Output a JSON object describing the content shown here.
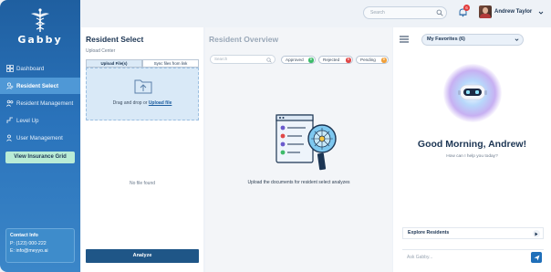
{
  "brand": {
    "name": "Gabby"
  },
  "sidebar": {
    "items": [
      {
        "label": "Dashboard",
        "icon": "grid-icon",
        "active": false
      },
      {
        "label": "Resident Select",
        "icon": "user-search-icon",
        "active": true
      },
      {
        "label": "Resident Management",
        "icon": "users-icon",
        "active": false
      },
      {
        "label": "Level Up",
        "icon": "level-up-icon",
        "active": false
      },
      {
        "label": "User Management",
        "icon": "users-cog-icon",
        "active": false
      }
    ],
    "insurance_button": "View Insurance Grid",
    "contact": {
      "title": "Contact Info",
      "phone": "P: (123) 000-222",
      "email": "E: info@meyyo.ai"
    }
  },
  "topbar": {
    "search_placeholder": "Search",
    "notification_count": "6",
    "user_name": "Andrew Taylor"
  },
  "resident_select": {
    "title": "Resident Select",
    "upload_center": "Upload Center",
    "tabs": [
      "Upload File(s)",
      "Sync files from link"
    ],
    "drop_text": "Drag and drop or",
    "drop_link": "Upload file",
    "empty_text": "No file found",
    "analyze_button": "Analyze"
  },
  "resident_overview": {
    "title": "Resident Overview",
    "search_placeholder": "Search",
    "chips": [
      {
        "label": "Approved",
        "count": "0",
        "color": "#3dbb6a"
      },
      {
        "label": "Rejected",
        "count": "0",
        "color": "#e04848"
      },
      {
        "label": "Pending",
        "count": "0",
        "color": "#f0a03a"
      }
    ],
    "message": "Upload the documents for resident select analyzes"
  },
  "assistant": {
    "favorites_label": "My Favorites (6)",
    "greeting": "Good Morning, Andrew!",
    "subtext": "How can I help you today?",
    "explore_label": "Explore Residents",
    "ask_placeholder": "Ask Gabby..."
  },
  "colors": {
    "sidebar": "#2a73bb",
    "accent": "#1f5687",
    "insurance_button": "#b9ecd6"
  }
}
